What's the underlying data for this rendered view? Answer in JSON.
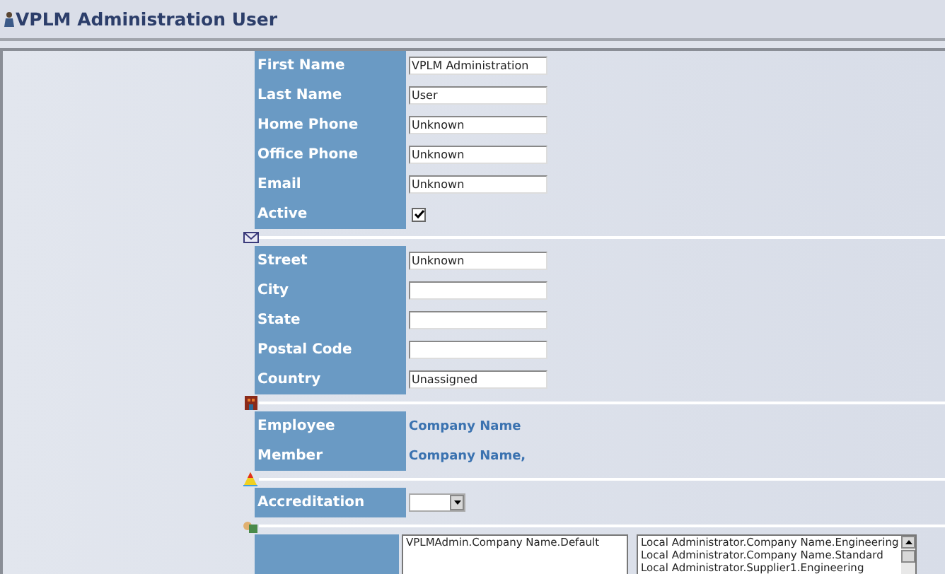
{
  "window": {
    "title": "VPLM Administration User"
  },
  "sections": [
    {
      "rows": [
        {
          "kind": "text",
          "label": "First Name",
          "value": "VPLM Administration"
        },
        {
          "kind": "text",
          "label": "Last Name",
          "value": "User"
        },
        {
          "kind": "text",
          "label": "Home Phone",
          "value": "Unknown"
        },
        {
          "kind": "text",
          "label": "Office Phone",
          "value": "Unknown"
        },
        {
          "kind": "text",
          "label": "Email",
          "value": "Unknown"
        },
        {
          "kind": "checkbox",
          "label": "Active",
          "checked": true
        }
      ]
    },
    {
      "rows": [
        {
          "kind": "text",
          "label": "Street",
          "value": "Unknown"
        },
        {
          "kind": "text",
          "label": "City"
        },
        {
          "kind": "text",
          "label": "State"
        },
        {
          "kind": "text",
          "label": "Postal Code"
        },
        {
          "kind": "text",
          "label": "Country",
          "value": "Unassigned"
        }
      ]
    },
    {
      "rows": [
        {
          "kind": "link",
          "label": "Employee",
          "value": "Company Name"
        },
        {
          "kind": "link",
          "label": "Member",
          "value": "Company Name,"
        }
      ]
    },
    {
      "rows": [
        {
          "kind": "select",
          "label": "Accreditation"
        }
      ]
    },
    {
      "rows": [
        {
          "kind": "lists",
          "lists": [
            [
              "VPLMAdmin.Company Name.Default"
            ],
            [
              "Local Administrator.Company Name.Engineering",
              "Local Administrator.Company Name.Standard",
              "Local Administrator.Supplier1.Engineering"
            ]
          ]
        }
      ]
    }
  ]
}
